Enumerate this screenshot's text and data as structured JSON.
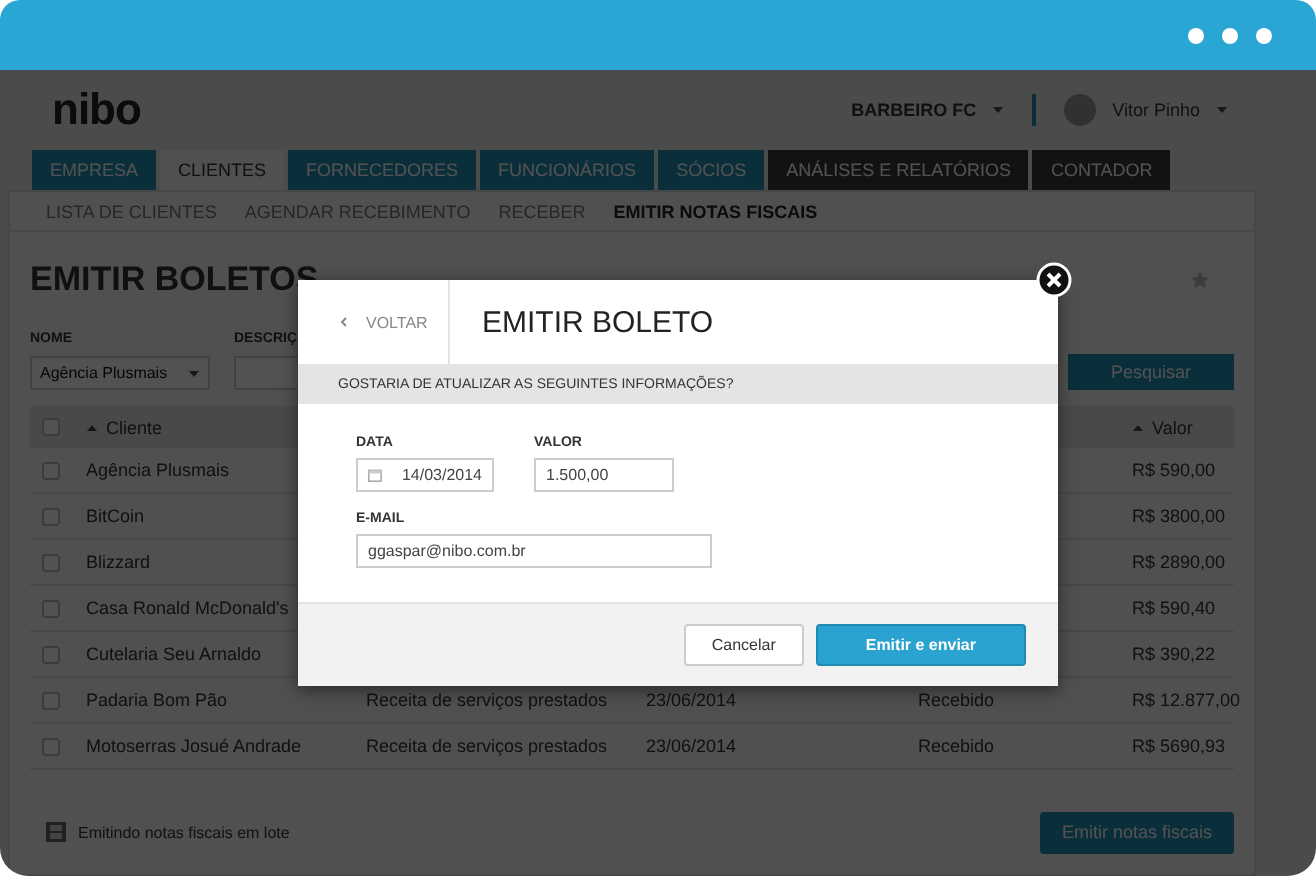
{
  "logo": "nibo",
  "header": {
    "company": "BARBEIRO FC",
    "user": "Vitor Pinho"
  },
  "tabs": [
    {
      "label": "EMPRESA",
      "selected": false,
      "kind": "module"
    },
    {
      "label": "CLIENTES",
      "selected": true,
      "kind": "module"
    },
    {
      "label": "FORNECEDORES",
      "selected": false,
      "kind": "module"
    },
    {
      "label": "FUNCIONÁRIOS",
      "selected": false,
      "kind": "module"
    },
    {
      "label": "SÓCIOS",
      "selected": false,
      "kind": "module"
    },
    {
      "label": "ANÁLISES E RELATÓRIOS",
      "selected": false,
      "kind": "report"
    },
    {
      "label": "CONTADOR",
      "selected": false,
      "kind": "report"
    }
  ],
  "subtabs": [
    {
      "label": "LISTA DE CLIENTES",
      "selected": false
    },
    {
      "label": "AGENDAR RECEBIMENTO",
      "selected": false
    },
    {
      "label": "RECEBER",
      "selected": false
    },
    {
      "label": "EMITIR NOTAS FISCAIS",
      "selected": true
    }
  ],
  "page": {
    "title": "EMITIR BOLETOS"
  },
  "filters": [
    {
      "label": "NOME",
      "value": "Agência Plusmais",
      "kind": "select"
    },
    {
      "label": "DESCRIÇ",
      "kind": "text"
    }
  ],
  "search_button": "Pesquisar",
  "table": {
    "header_checked": false,
    "columns": [
      {
        "label": "Cliente"
      },
      {
        "label": "Valor"
      }
    ],
    "rows": [
      {
        "checked": false,
        "cliente": "Agência Plusmais",
        "valor": "R$ 590,00"
      },
      {
        "checked": false,
        "cliente": "BitCoin",
        "valor": "R$ 3800,00"
      },
      {
        "checked": false,
        "cliente": "Blizzard",
        "valor": "R$ 2890,00"
      },
      {
        "checked": false,
        "cliente": "Casa Ronald McDonald's",
        "valor": "R$ 590,40"
      },
      {
        "checked": false,
        "cliente": "Cutelaria Seu Arnaldo",
        "valor": "R$ 390,22"
      },
      {
        "checked": false,
        "cliente": "Padaria Bom Pão",
        "column_2": "Receita de serviços prestados",
        "column_3": "23/06/2014",
        "column_4": "Recebido",
        "valor": "R$ 12.877,00"
      },
      {
        "checked": false,
        "cliente": "Motoserras Josué Andrade",
        "column_2": "Receita de serviços prestados",
        "column_3": "23/06/2014",
        "column_4": "Recebido",
        "valor": "R$ 5690,93"
      }
    ]
  },
  "footer": {
    "label": "Emitindo notas fiscais em lote",
    "button": "Emitir notas fiscais"
  },
  "modal": {
    "back": "VOLTAR",
    "title": "EMITIR BOLETO",
    "prompt": "GOSTARIA DE ATUALIZAR AS SEGUINTES INFORMAÇÕES?",
    "fields": [
      {
        "label": "DATA",
        "value": "14/03/2014",
        "kind": "date"
      },
      {
        "label": "VALOR",
        "value": "1.500,00",
        "kind": "text"
      },
      {
        "label": "E-MAIL",
        "value": "ggaspar@nibo.com.br",
        "kind": "email"
      }
    ],
    "buttons": [
      {
        "label": "Cancelar",
        "kind": "secondary"
      },
      {
        "label": "Emitir e enviar",
        "kind": "primary"
      }
    ]
  }
}
